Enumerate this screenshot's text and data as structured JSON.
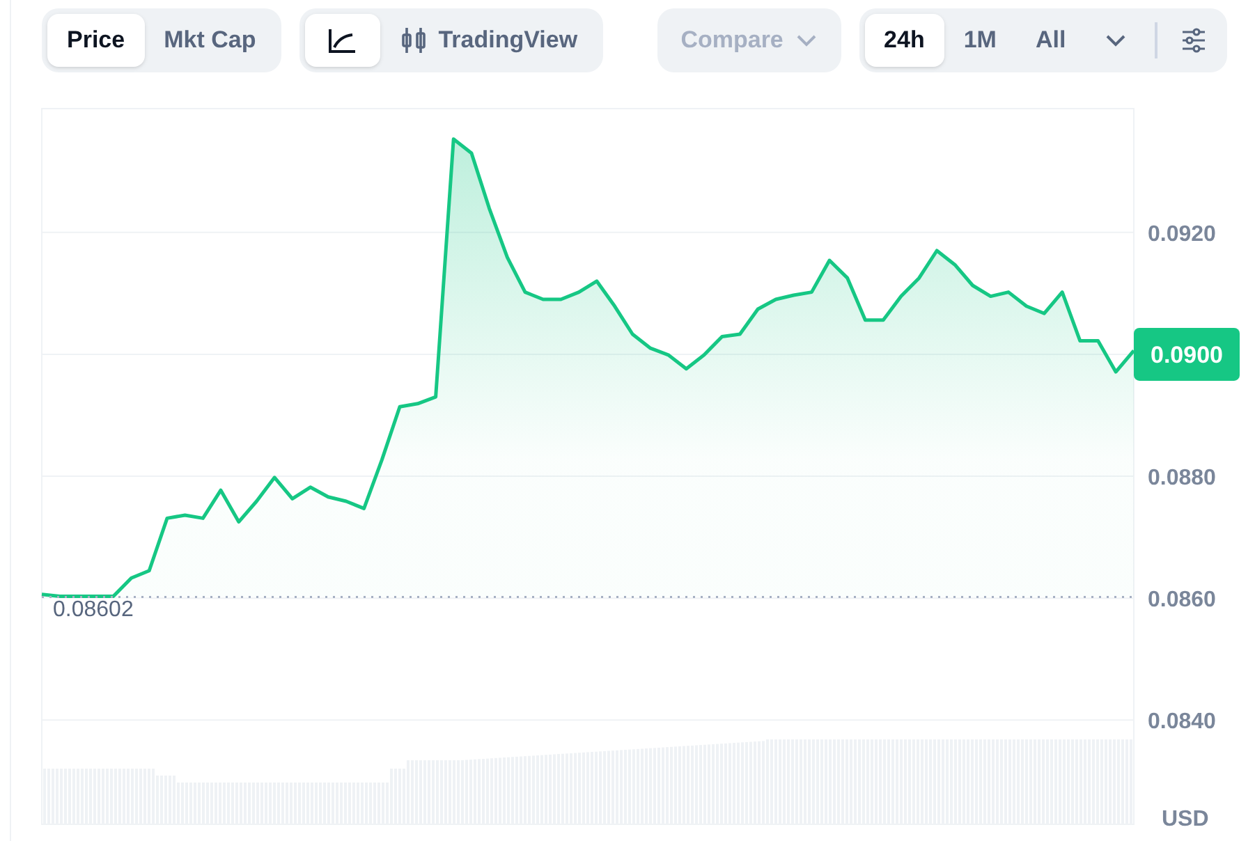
{
  "toolbar": {
    "metric_tabs": [
      {
        "label": "Price",
        "selected": true
      },
      {
        "label": "Mkt Cap",
        "selected": false
      }
    ],
    "view_tabs": [
      {
        "kind": "line",
        "selected": true
      },
      {
        "kind": "candles",
        "label": "TradingView",
        "selected": false
      }
    ],
    "compare": {
      "label": "Compare",
      "disabled": true
    },
    "range_tabs": [
      {
        "label": "24h",
        "selected": true
      },
      {
        "label": "1M",
        "selected": false
      },
      {
        "label": "All",
        "selected": false
      }
    ]
  },
  "chart": {
    "chart_data": {
      "type": "area",
      "grid": true,
      "ylabel": "USD",
      "ylim": [
        0.08229,
        0.09403
      ],
      "yticks": [
        {
          "value": 0.092,
          "label": "0.0920"
        },
        {
          "value": 0.09,
          "label": "0.0900"
        },
        {
          "value": 0.088,
          "label": "0.0880"
        },
        {
          "value": 0.086,
          "label": "0.0860"
        },
        {
          "value": 0.084,
          "label": "0.0840"
        }
      ],
      "series": [
        {
          "color": "#16c784",
          "values": [
            0.08606,
            0.08603,
            0.08603,
            0.08603,
            0.08603,
            0.08633,
            0.08645,
            0.08731,
            0.08736,
            0.08731,
            0.08777,
            0.08725,
            0.08759,
            0.08798,
            0.08763,
            0.08782,
            0.08766,
            0.08759,
            0.08747,
            0.08827,
            0.08914,
            0.08919,
            0.0893,
            0.09353,
            0.0933,
            0.09239,
            0.09159,
            0.09102,
            0.0909,
            0.0909,
            0.09102,
            0.0912,
            0.09079,
            0.09033,
            0.0901,
            0.08999,
            0.08976,
            0.08999,
            0.09029,
            0.09033,
            0.09074,
            0.0909,
            0.09097,
            0.09102,
            0.09154,
            0.09125,
            0.09056,
            0.09056,
            0.09095,
            0.09125,
            0.0917,
            0.09147,
            0.09113,
            0.09095,
            0.09102,
            0.09079,
            0.09067,
            0.09102,
            0.09022,
            0.09022,
            0.08971,
            0.09006
          ]
        }
      ],
      "ref_lines": [
        {
          "axis": "y",
          "value": 0.08602,
          "label": "0.08602"
        }
      ]
    }
  }
}
